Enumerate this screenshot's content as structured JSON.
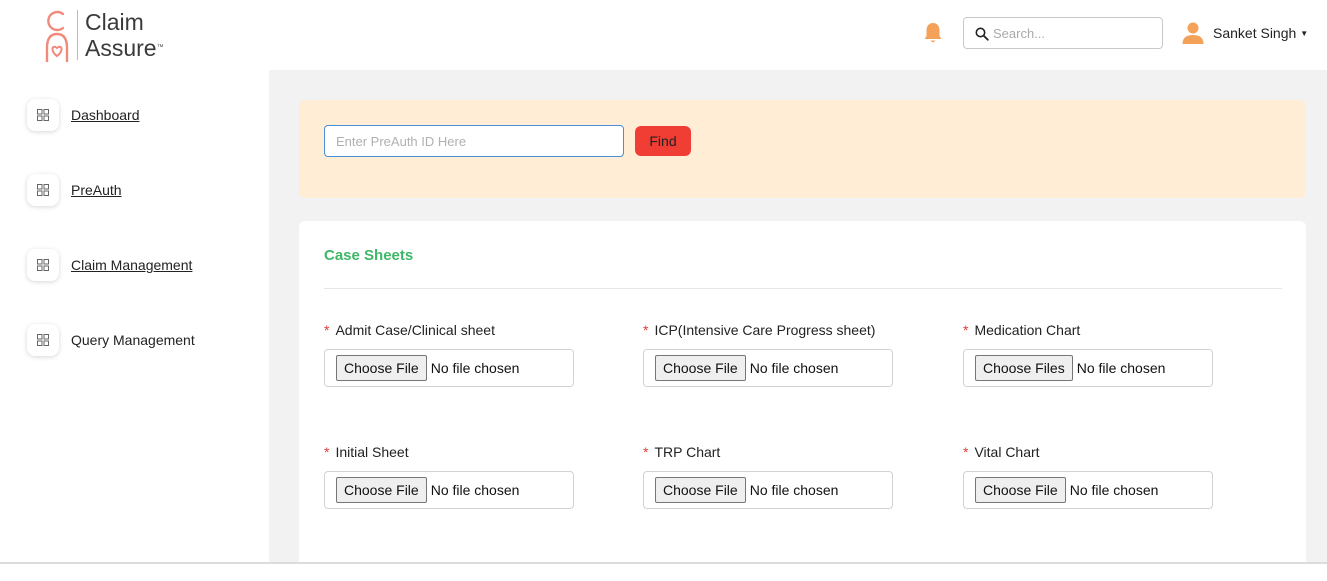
{
  "brand": {
    "line1": "Claim",
    "line2": "Assure",
    "tm": "™"
  },
  "header": {
    "search_placeholder": "Search...",
    "user_name": "Sanket Singh"
  },
  "sidebar": {
    "items": [
      {
        "label": "Dashboard"
      },
      {
        "label": "PreAuth"
      },
      {
        "label": "Claim Management"
      },
      {
        "label": "Query Management"
      }
    ]
  },
  "finder": {
    "placeholder": "Enter PreAuth ID Here",
    "button_label": "Find"
  },
  "case_sheets": {
    "title": "Case Sheets",
    "required_mark": "*",
    "fields": [
      {
        "label": "Admit Case/Clinical sheet",
        "button": "Choose File",
        "status": "No file chosen"
      },
      {
        "label": "ICP(Intensive Care Progress sheet)",
        "button": "Choose File",
        "status": "No file chosen"
      },
      {
        "label": "Medication Chart",
        "button": "Choose Files",
        "status": "No file chosen"
      },
      {
        "label": "Initial Sheet",
        "button": "Choose File",
        "status": "No file chosen"
      },
      {
        "label": "TRP Chart",
        "button": "Choose File",
        "status": "No file chosen"
      },
      {
        "label": "Vital Chart",
        "button": "Choose File",
        "status": "No file chosen"
      }
    ]
  },
  "colors": {
    "brand_accent": "#f08a7c",
    "bell": "#f4a25a",
    "find_panel_bg": "#ffedd6",
    "find_button": "#f13e34",
    "section_title": "#3eb868",
    "required": "#e53935"
  },
  "icons": [
    "claim-assure-logo-icon",
    "bell-icon",
    "search-icon",
    "user-avatar-icon",
    "caret-down-icon",
    "grid-icon"
  ]
}
